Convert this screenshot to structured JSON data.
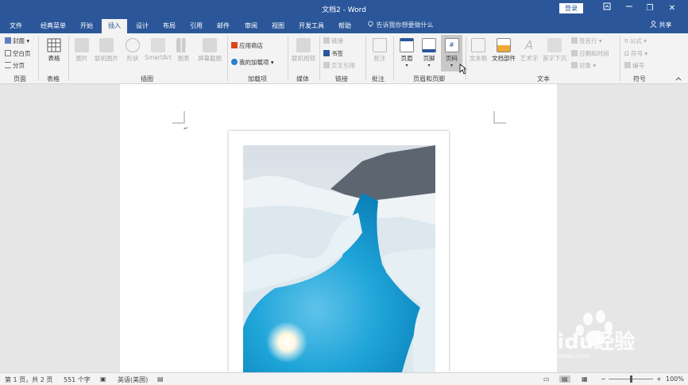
{
  "titlebar": {
    "title": "文档2 - Word",
    "login": "登录",
    "restore_glyph": "❐",
    "close_glyph": "✕"
  },
  "tabs": [
    "文件",
    "经典菜单",
    "开始",
    "插入",
    "设计",
    "布局",
    "引用",
    "邮件",
    "审阅",
    "视图",
    "开发工具",
    "帮助"
  ],
  "tell_me": "告诉我你想要做什么",
  "share": "共享",
  "ribbon": {
    "pages": {
      "cover": "封面",
      "blank": "空白页",
      "break": "分页",
      "label": "页面"
    },
    "table": {
      "table": "表格",
      "label": "表格"
    },
    "illustrations": {
      "picture": "图片",
      "online_picture": "联机图片",
      "shapes": "形状",
      "smartart": "SmartArt",
      "chart": "图表",
      "screenshot": "屏幕截图",
      "label": "插图"
    },
    "addins": {
      "store": "应用商店",
      "my_addins": "我的加载项",
      "label": "加载项"
    },
    "media": {
      "online_video": "联机视频",
      "label": "媒体"
    },
    "links": {
      "link": "链接",
      "bookmark": "书签",
      "cross_ref": "交叉引用",
      "label": "链接"
    },
    "comments": {
      "comment": "批注",
      "label": "批注"
    },
    "header_footer": {
      "header": "页眉",
      "footer": "页脚",
      "page_number": "页码",
      "label": "页眉和页脚"
    },
    "text": {
      "text_box": "文本框",
      "quick_parts": "文档部件",
      "wordart": "艺术字",
      "drop_cap": "首字下沉",
      "signature_line": "签名行",
      "date_time": "日期和时间",
      "object": "对象",
      "label": "文本"
    },
    "symbols": {
      "equation": "公式",
      "symbol": "符号",
      "number": "编号",
      "label": "符号"
    }
  },
  "status": {
    "page": "第 1 页，共 2 页",
    "words": "551 个字",
    "language": "英语(美国)",
    "zoom": "100%",
    "zoom_fraction": 0.5
  },
  "watermark": {
    "brand": "Baidu经验",
    "url": "jingyan.baidu.com"
  },
  "colors": {
    "brand": "#2b579a",
    "ribbon_bg": "#f3f3f3",
    "canvas_bg": "#e6e6e6"
  }
}
